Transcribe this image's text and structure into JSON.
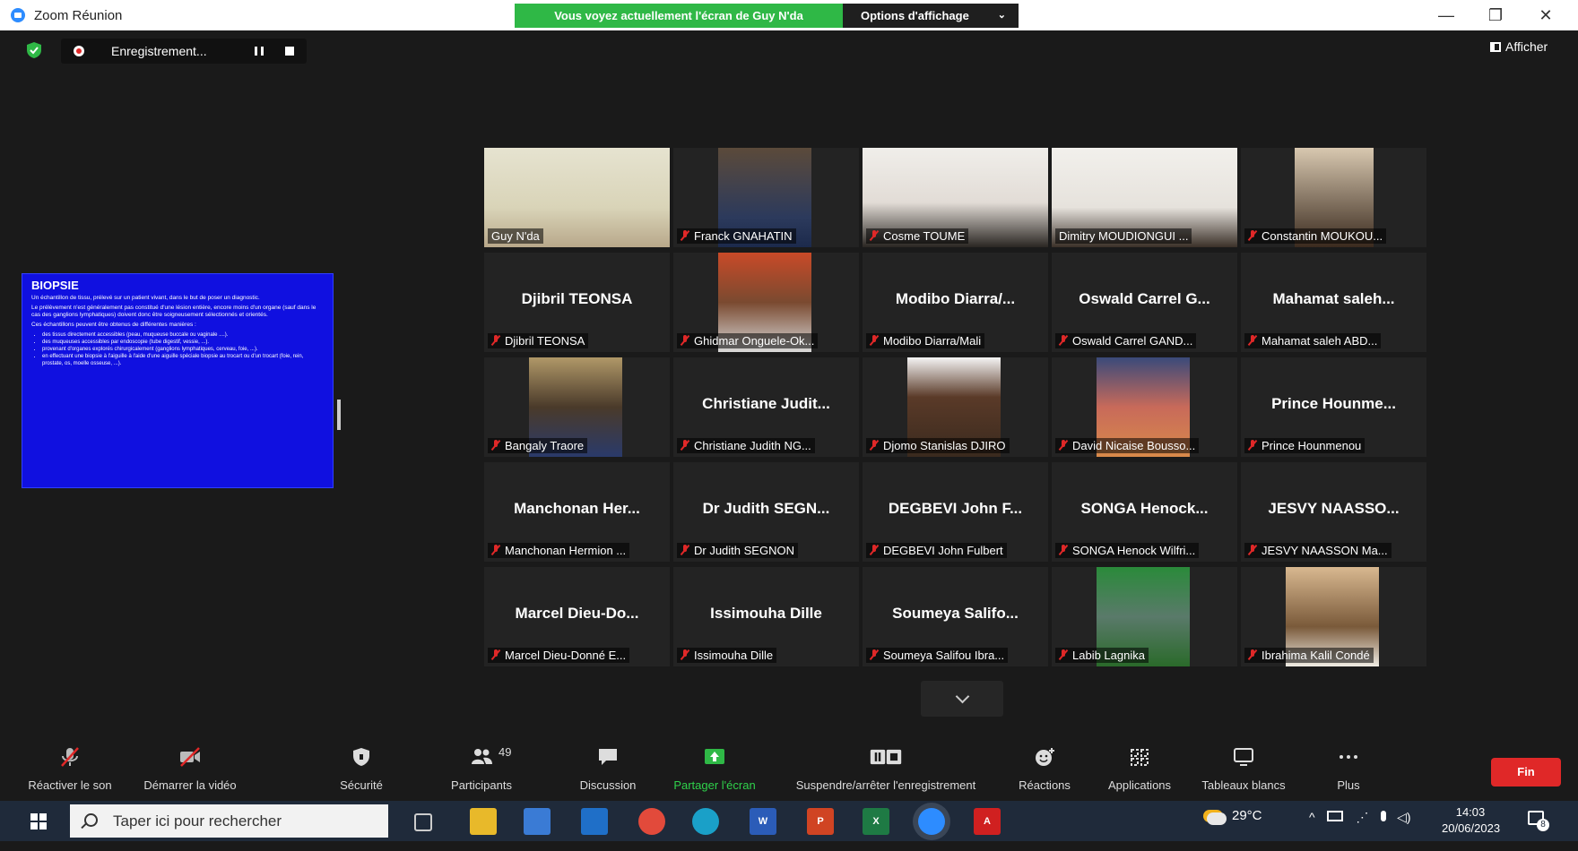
{
  "window": {
    "title": "Zoom Réunion",
    "minimize": "—",
    "restore": "❐",
    "close": "✕"
  },
  "share_banner": "Vous voyez actuellement l'écran de Guy N'da",
  "view_options": {
    "label": "Options d'affichage"
  },
  "recording": {
    "label": "Enregistrement..."
  },
  "afficher_label": "Afficher",
  "slide": {
    "heading": "BIOPSIE",
    "line1": "Un échantillon de tissu, prélevé sur un patient vivant, dans le but de poser un diagnostic.",
    "line2": "Le prélèvement n'est généralement pas constitué d'une lésion entière, encore moins d'un organe (sauf dans le cas des ganglions lymphatiques) doivent donc être soigneusement sélectionnés et orientés.",
    "line3": "Ces échantillons peuvent être obtenus de différentes manières :",
    "bullets": [
      "des tissus directement accessibles (peau, muqueuse buccale ou vaginale ....).",
      "des muqueuses accessibles par endoscopie (tube digestif, vessie, ...).",
      "provenant d'organes explorés chirurgicalement (ganglions lymphatiques, cerveau, foie, ...).",
      "en effectuant une biopsie à l'aiguille à l'aide d'une aiguille spéciale biopsie au trocart ou d'un trocart (foie, rein, prostate, os, moelle osseuse, ...)."
    ]
  },
  "participants": [
    {
      "tag": "Guy N'da",
      "photo": true,
      "active": true,
      "muted": false
    },
    {
      "tag": "Franck GNAHATIN",
      "photo": true,
      "muted": true
    },
    {
      "tag": "Cosme TOUME",
      "photo": true,
      "muted": true
    },
    {
      "tag": "Dimitry MOUDIONGUI ...",
      "photo": true,
      "muted": false
    },
    {
      "tag": "Constantin MOUKOU...",
      "photo": true,
      "muted": true
    },
    {
      "big": "Djibril TEONSA",
      "tag": "Djibril TEONSA",
      "muted": true
    },
    {
      "tag": "Ghidmar Onguele-Ok...",
      "photo": true,
      "muted": true
    },
    {
      "big": "Modibo Diarra/...",
      "tag": "Modibo Diarra/Mali",
      "muted": true
    },
    {
      "big": "Oswald Carrel G...",
      "tag": "Oswald Carrel GAND...",
      "muted": true
    },
    {
      "big": "Mahamat saleh...",
      "tag": "Mahamat saleh ABD...",
      "muted": true
    },
    {
      "tag": "Bangaly Traore",
      "photo": true,
      "muted": true
    },
    {
      "big": "Christiane Judit...",
      "tag": "Christiane Judith NG...",
      "muted": true
    },
    {
      "tag": "Djomo Stanislas DJIRO",
      "photo": true,
      "muted": true
    },
    {
      "tag": "David Nicaise Bousso...",
      "photo": true,
      "muted": true
    },
    {
      "big": "Prince Hounme...",
      "tag": "Prince Hounmenou",
      "muted": true
    },
    {
      "big": "Manchonan Her...",
      "tag": "Manchonan Hermion ...",
      "muted": true
    },
    {
      "big": "Dr Judith SEGN...",
      "tag": "Dr Judith SEGNON",
      "muted": true
    },
    {
      "big": "DEGBEVI John F...",
      "tag": "DEGBEVI John Fulbert",
      "muted": true
    },
    {
      "big": "SONGA Henock...",
      "tag": "SONGA Henock Wilfri...",
      "muted": true
    },
    {
      "big": "JESVY NAASSO...",
      "tag": "JESVY NAASSON Ma...",
      "muted": true
    },
    {
      "big": "Marcel Dieu-Do...",
      "tag": "Marcel Dieu-Donné E...",
      "muted": true
    },
    {
      "big": "Issimouha Dille",
      "tag": "Issimouha Dille",
      "muted": true
    },
    {
      "big": "Soumeya Salifo...",
      "tag": "Soumeya Salifou Ibra...",
      "muted": true
    },
    {
      "tag": "Labib Lagnika",
      "photo": true,
      "muted": true
    },
    {
      "tag": "Ibrahima Kalil Condé",
      "photo": true,
      "muted": true
    }
  ],
  "controls": {
    "unmute": "Réactiver le son",
    "start_video": "Démarrer la vidéo",
    "security": "Sécurité",
    "participants": "Participants",
    "participants_count": "49",
    "chat": "Discussion",
    "share": "Partager l'écran",
    "record": "Suspendre/arrêter l'enregistrement",
    "reactions": "Réactions",
    "apps": "Applications",
    "whiteboards": "Tableaux blancs",
    "more": "Plus",
    "end": "Fin"
  },
  "taskbar": {
    "search_placeholder": "Taper ici pour rechercher",
    "weather": "29°C",
    "time": "14:03",
    "date": "20/06/2023",
    "notif_count": "8"
  },
  "colors": {
    "share_green": "#2fb846",
    "muted_red": "#e02828",
    "active_border": "#e8e85a",
    "slide_blue": "#1010e0"
  }
}
